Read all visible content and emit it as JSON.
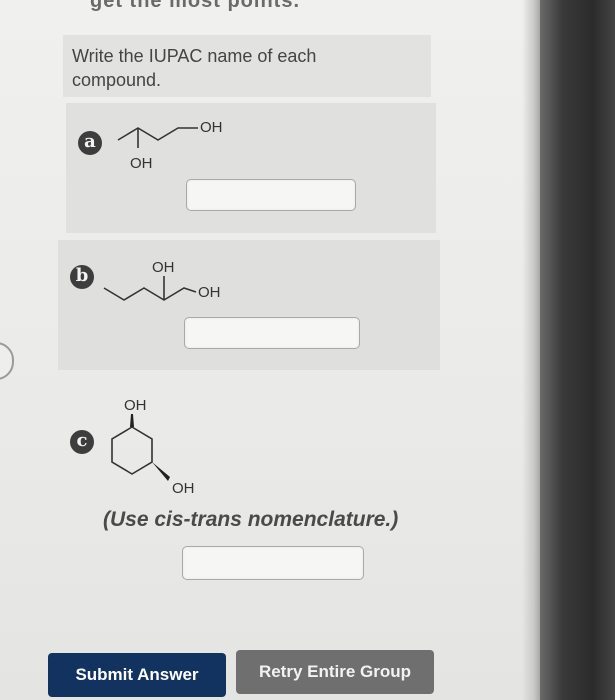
{
  "header_fragment": "get the most points.",
  "question": {
    "prompt": "Write the IUPAC name of each compound."
  },
  "parts": [
    {
      "badge": "a",
      "labels": [
        "OH",
        "OH"
      ],
      "answer": "",
      "note": ""
    },
    {
      "badge": "b",
      "labels": [
        "OH",
        "OH"
      ],
      "answer": "",
      "note": ""
    },
    {
      "badge": "c",
      "labels": [
        "OH",
        "OH"
      ],
      "answer": "",
      "note": "(Use cis-trans nomenclature.)"
    }
  ],
  "buttons": {
    "submit": "Submit Answer",
    "retry": "Retry Entire Group"
  },
  "colors": {
    "submit_bg": "#12325f",
    "retry_bg": "#6f6f6f",
    "badge_bg": "#3d3d3d"
  }
}
